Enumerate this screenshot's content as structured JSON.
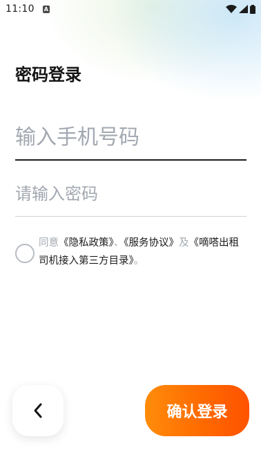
{
  "status_bar": {
    "time": "11:10",
    "notification_icon": "a-badge-icon",
    "icons": [
      "wifi-icon",
      "signal-icon",
      "battery-icon"
    ]
  },
  "title": "密码登录",
  "phone": {
    "placeholder": "输入手机号码",
    "value": ""
  },
  "password": {
    "placeholder": "请输入密码",
    "value": ""
  },
  "agreement": {
    "checked": false,
    "prefix": "同意",
    "privacy_policy": "《隐私政策》",
    "separator": "、",
    "service_agreement": "《服务协议》",
    "and": "及",
    "driver_agreement": "《嘀嗒出租司机接入第三方目录》",
    "suffix": "。"
  },
  "buttons": {
    "back_icon": "chevron-left-icon",
    "confirm_label": "确认登录"
  },
  "colors": {
    "accent_start": "#ff8c0a",
    "accent_end": "#ff5200",
    "placeholder": "#a2a8b0",
    "text": "#141414"
  }
}
